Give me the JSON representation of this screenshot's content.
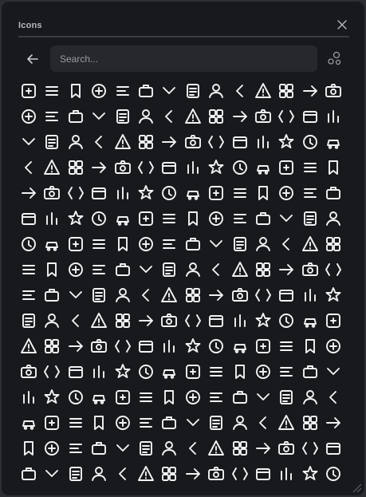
{
  "panel": {
    "title": "Icons",
    "search_placeholder": "Search..."
  },
  "header_icons": [
    "close-icon",
    "arrow-left-icon",
    "shapes-icon"
  ],
  "icons": [
    "rotate-24-icon",
    "4k-icon",
    "sort-az-icon",
    "user-square-icon",
    "user-circle-icon",
    "user-badge-icon",
    "user-pin-icon",
    "plus-square-icon",
    "plus-circle-icon",
    "plus-icon",
    "plus-small-icon",
    "user-lock-icon",
    "ad-icon",
    "copy-icon",
    "bolt-square-icon",
    "square-plus-icon",
    "airplay-icon",
    "alarm-icon",
    "siren-icon",
    "disc-icon",
    "alert-triangle-icon",
    "alias-icon",
    "alien-icon",
    "align-bottom-icon",
    "align-justify-icon",
    "align-h-icon",
    "align-center-icon",
    "align-left-icon",
    "align-right-icon",
    "align-top-icon",
    "align-v-center-icon",
    "menu-icon",
    "text-left-icon",
    "text-right-icon",
    "arrow-top-bar-icon",
    "collapse-v-icon",
    "ampersand-circle-icon",
    "amazon-icon",
    "anchor-icon",
    "house-icon",
    "house-outline-icon",
    "android-icon",
    "angular-icon",
    "arrow-up-right-square-icon",
    "arrow-up-left-square-icon",
    "app-store-icon",
    "apple-icon",
    "apps-add-icon",
    "apps-icon",
    "command-icon",
    "archive-icon",
    "archive-lines-icon",
    "archive-box-icon",
    "armchair-icon",
    "sofa-icon",
    "arrow-down-circle-icon",
    "chevrons-down-icon",
    "arrow-down-icon",
    "chevron-down-icon",
    "chevron-down-wide-icon",
    "chevron-down-small-icon",
    "chevron-left-small-icon",
    "chevron-right-small-icon",
    "chevron-up-small-icon",
    "undo-icon",
    "redo-icon",
    "arrow-left-circle-icon",
    "chevrons-left-icon",
    "arrow-down-left-icon",
    "arrow-left-icon",
    "swap-icon",
    "chevron-left-icon",
    "arrow-up-left-icon",
    "angle-left-icon",
    "arrow-right-circle-icon",
    "chevrons-right-icon",
    "arrow-down-right-icon",
    "arrow-right-icon",
    "chevron-right-icon",
    "arrow-up-right-icon",
    "angle-right-icon",
    "u-turn-icon",
    "rotate-up-icon",
    "arrow-up-circle-icon",
    "chevrons-up-icon",
    "arrows-up-down-icon",
    "arrow-up-icon",
    "chevron-up-icon",
    "chevron-up-wide-icon",
    "artboard-icon",
    "podium-icon",
    "article-icon",
    "aspect-ratio-icon",
    "asterisk-icon",
    "at-icon",
    "paperclip-icon",
    "attachment-icon",
    "gavel-icon",
    "award-icon",
    "paw-icon",
    "pencil-icon",
    "credit-card-icon",
    "wallet-icon",
    "bank-icon",
    "bar-chart-icon",
    "chart-square-icon",
    "bar-chart-vertical-icon",
    "bars-left-icon",
    "bars-up-icon",
    "barcode-icon",
    "barcode-full-icon",
    "sparkles-icon",
    "cone-icon",
    "broadcast-icon",
    "basketball-icon",
    "battery-bolt-icon",
    "battery-icon",
    "battery-charging-icon",
    "battery-empty-icon",
    "battery-half-icon",
    "battery-plus-icon",
    "battery-refresh-icon",
    "bear-icon",
    "bucket-icon",
    "behance-icon",
    "bell-off-icon",
    "bike-icon",
    "tv-icon",
    "file-text-icon",
    "bitcoin-icon",
    "bitcoin-square-icon",
    "flame-icon",
    "blender-icon",
    "blogger-icon",
    "butterfly-icon",
    "bluetooth-icon",
    "bluetooth-off-icon",
    "no-drop-icon",
    "cube-icon",
    "focus-icon",
    "bold-icon",
    "book-icon",
    "book-open-back-icon",
    "book-closed-icon",
    "bookmark-book-icon",
    "book-open-icon",
    "book-list-icon",
    "books-icon",
    "bookmark-icon",
    "bookmark-star-icon",
    "bookmark-empty-icon",
    "curly-box-icon",
    "bowl-icon",
    "box-icon",
    "cube-solid-icon",
    "package-icon",
    "basket-icon",
    "braces-icon",
    "brackets-icon",
    "clover-icon",
    "bread-icon",
    "briefcase-icon",
    "briefcase-alt-icon",
    "suitcase-icon",
    "luggage-icon",
    "bag-icon",
    "square-stack-icon",
    "squares-icon",
    "broadcast-alt-icon",
    "brush-icon",
    "building-icon",
    "monitor-icon",
    "paint-brush-icon",
    "bitcoin-coin-icon",
    "bubbles-icon",
    "bug-icon",
    "beetle-icon",
    "buildings-icon",
    "factory-icon",
    "city-icon",
    "office-icon",
    "bus-icon",
    "bus-front-icon",
    "bus-smile-icon",
    "cactus-icon",
    "cake-icon",
    "cupcake-icon",
    "candle-icon",
    "calculator-icon",
    "calendar-icon",
    "calendar-check-icon",
    "calendar-x-icon",
    "calendar-minus-icon",
    "calendar-plus-icon",
    "calendar-clock-icon",
    "calendar-event-icon",
    "window-icon",
    "camera-square-icon",
    "camera-icon",
    "aperture-icon",
    "photo-camera-icon",
    "camera-off-icon",
    "camera-rotate-icon",
    "candle-stick-icon",
    "capsule-icon",
    "car-icon",
    "car-front-icon",
    "truck-icon",
    "columns-icon",
    "cash-icon",
    "doc-icon",
    "file-flag-icon",
    "swirl-icon",
    "cross-grid-icon",
    "image-a-icon",
    "flag-card-icon",
    "phone-card-icon",
    "circle-minus-icon",
    "clipboard-icon",
    "window-alt-icon",
    "screen-icon",
    "grid-small-icon",
    "terminal-icon",
    "document-icon"
  ]
}
